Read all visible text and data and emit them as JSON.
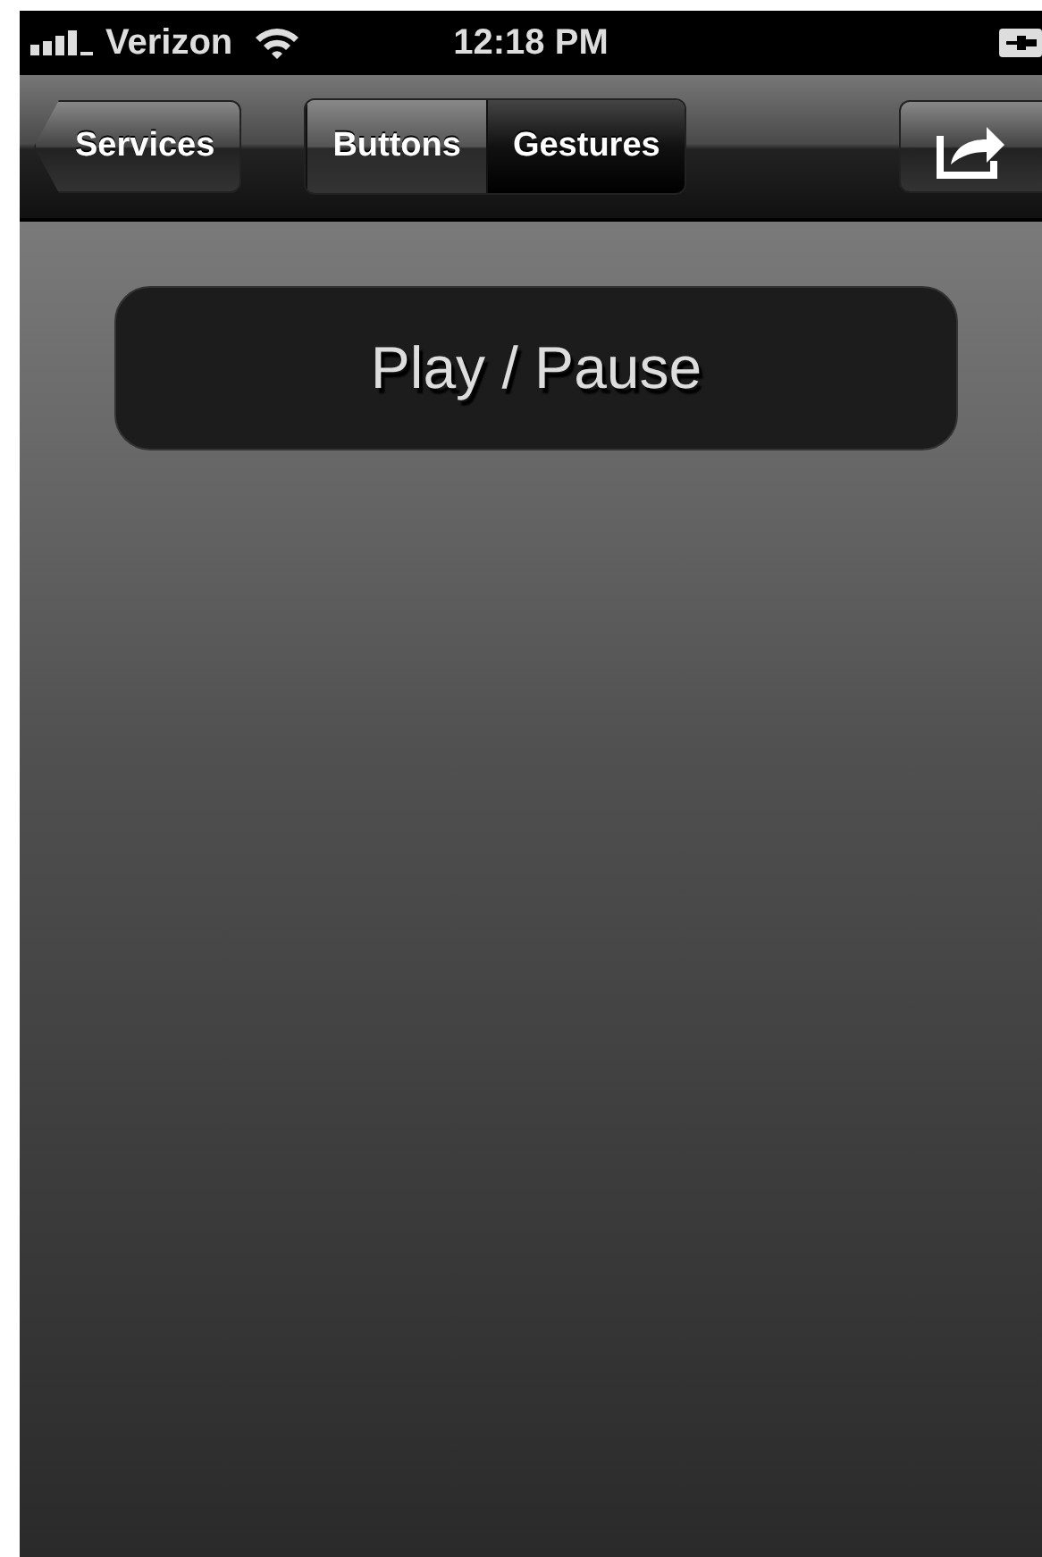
{
  "status_bar": {
    "carrier": "Verizon",
    "time": "12:18 PM"
  },
  "nav_bar": {
    "back_button": "Services",
    "segments": [
      {
        "label": "Buttons",
        "selected": false
      },
      {
        "label": "Gestures",
        "selected": true
      }
    ]
  },
  "buttons": [
    {
      "label": "Play / Pause"
    }
  ]
}
